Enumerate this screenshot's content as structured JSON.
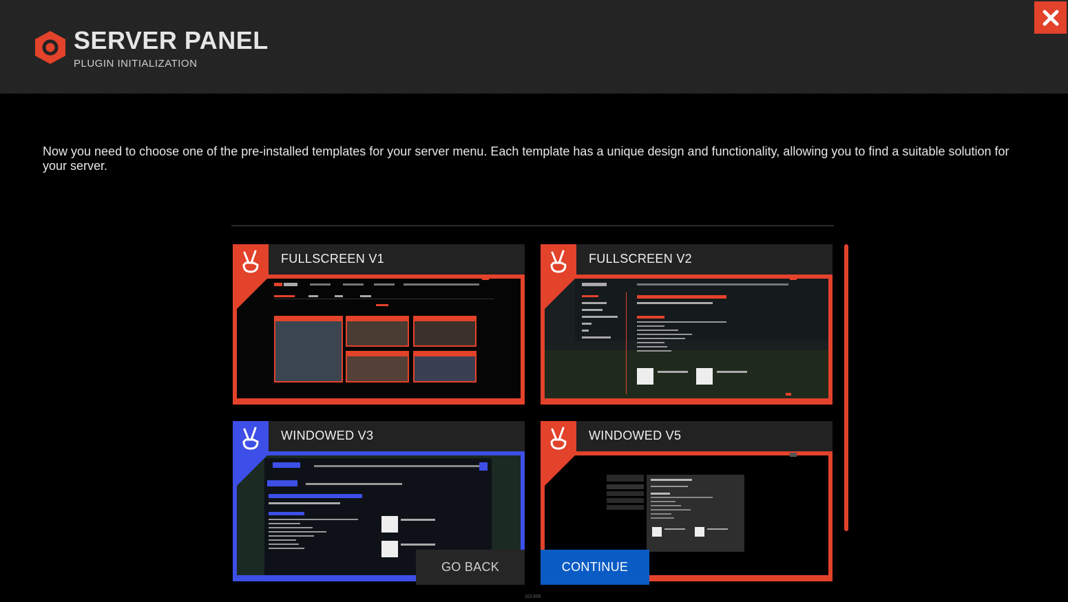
{
  "header": {
    "title": "SERVER PANEL",
    "subtitle": "PLUGIN INITIALIZATION"
  },
  "intro_text": "Now you need to choose one of the pre-installed templates for your server menu. Each template has a unique design and functionality, allowing you to find a suitable solution for your server.",
  "templates": [
    {
      "label": "FULLSCREEN V1",
      "accent": "#e3422b"
    },
    {
      "label": "FULLSCREEN V2",
      "accent": "#e3422b"
    },
    {
      "label": "WINDOWED V3",
      "accent": "#3d4fe6"
    },
    {
      "label": "WINDOWED V5",
      "accent": "#e3422b"
    }
  ],
  "buttons": {
    "go_back": "GO BACK",
    "continue": "CONTINUE"
  },
  "version": "101309",
  "colors": {
    "accent_red": "#e3422b",
    "accent_blue": "#3d4fe6",
    "continue_blue": "#0a5bc4"
  },
  "icons": {
    "logo": "hexagon-ring-icon",
    "close": "close-icon",
    "template_badge": "peace-hand-icon"
  }
}
